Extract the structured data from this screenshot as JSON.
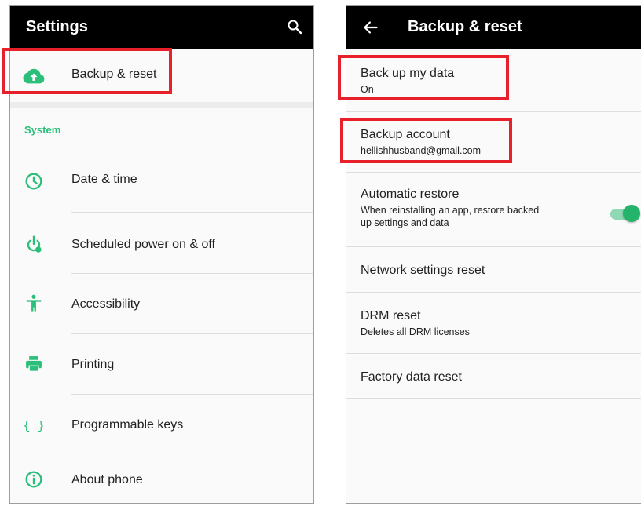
{
  "left": {
    "title": "Settings",
    "backup_item": "Backup & reset",
    "section_system": "System",
    "items": [
      {
        "label": "Date & time",
        "icon": "clock-icon"
      },
      {
        "label": "Scheduled power on & off",
        "icon": "power-schedule-icon"
      },
      {
        "label": "Accessibility",
        "icon": "accessibility-icon"
      },
      {
        "label": "Printing",
        "icon": "printer-icon"
      },
      {
        "label": "Programmable keys",
        "icon": "braces-icon"
      },
      {
        "label": "About phone",
        "icon": "info-icon"
      }
    ]
  },
  "right": {
    "title": "Backup & reset",
    "items": [
      {
        "title": "Back up my data",
        "summary": "On"
      },
      {
        "title": "Backup account",
        "summary": "hellishhusband@gmail.com"
      },
      {
        "title": "Automatic restore",
        "summary_line1": "When reinstalling an app, restore backed",
        "summary_line2": "up settings and data",
        "toggle": true
      },
      {
        "title": "Network settings reset"
      },
      {
        "title": "DRM reset",
        "summary": "Deletes all DRM licenses"
      },
      {
        "title": "Factory data reset"
      }
    ]
  },
  "colors": {
    "accent": "#2bbf7a",
    "highlight": "#e8202a",
    "appbar": "#000000"
  }
}
